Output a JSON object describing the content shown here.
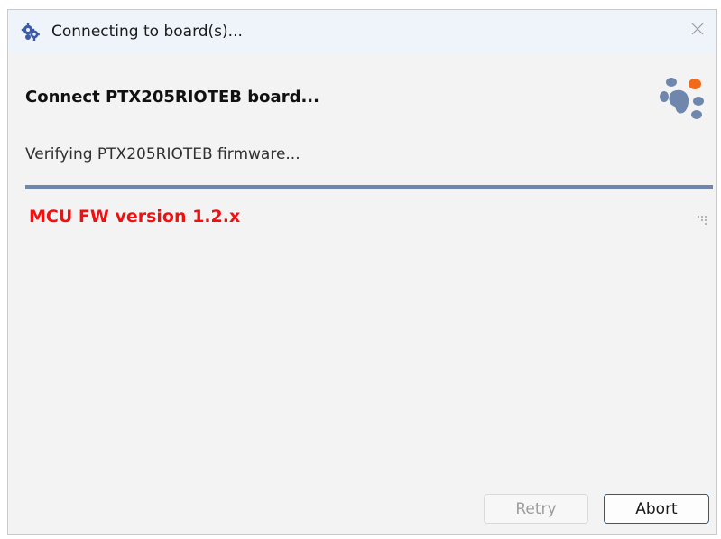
{
  "window": {
    "title": "Connecting to board(s)...",
    "app_icon": "gear-cluster-icon",
    "close_icon": "close-icon"
  },
  "main": {
    "heading": "Connect PTX205RIOTEB board...",
    "logo_icon": "paw-print-icon",
    "status": "Verifying PTX205RIOTEB firmware...",
    "progress": 1.0,
    "message": "MCU FW version 1.2.x",
    "grip_icon": "resize-grip-icon"
  },
  "buttons": {
    "retry_label": "Retry",
    "retry_enabled": false,
    "abort_label": "Abort"
  },
  "colors": {
    "accent": "#6f87ac",
    "message": "#f01010",
    "paw_blue": "#6f87ac",
    "paw_orange": "#f06a1a",
    "abort_border": "#2c5a8f"
  }
}
